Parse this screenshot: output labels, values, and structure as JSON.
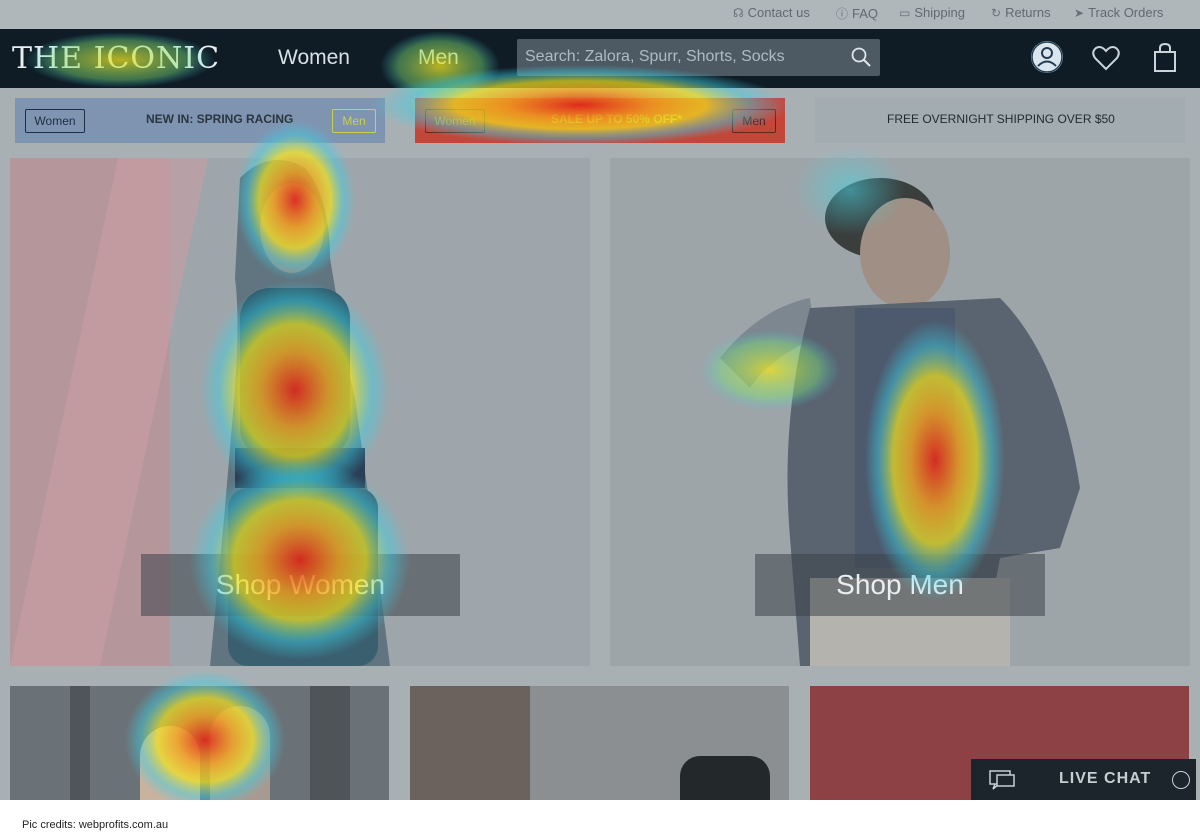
{
  "utility_links": [
    {
      "label": "Contact us",
      "icon": "headset-icon"
    },
    {
      "label": "FAQ",
      "icon": "question-icon"
    },
    {
      "label": "Shipping",
      "icon": "truck-icon"
    },
    {
      "label": "Returns",
      "icon": "returns-icon"
    },
    {
      "label": "Track Orders",
      "icon": "send-icon"
    }
  ],
  "nav": {
    "logo": "THE ICONIC",
    "women": "Women",
    "men": "Men",
    "search_placeholder": "Search: Zalora, Spurr, Shorts, Socks"
  },
  "promos": [
    {
      "left_pill": "Women",
      "text": "NEW IN: SPRING RACING",
      "right_pill": "Men"
    },
    {
      "left_pill": "Women",
      "text": "SALE UP TO 50% OFF*",
      "right_pill": "Men"
    },
    {
      "text": "FREE OVERNIGHT SHIPPING OVER $50"
    }
  ],
  "hero": {
    "shop_women": "Shop Women",
    "shop_men": "Shop Men"
  },
  "live_chat": "LIVE CHAT",
  "credit": "Pic credits: webprofits.com.au",
  "colors": {
    "nav_bg": "#0f1c26",
    "heat_red": "#e2261b",
    "heat_yellow": "#f2e41c",
    "heat_cyan": "#3ad0e6"
  }
}
